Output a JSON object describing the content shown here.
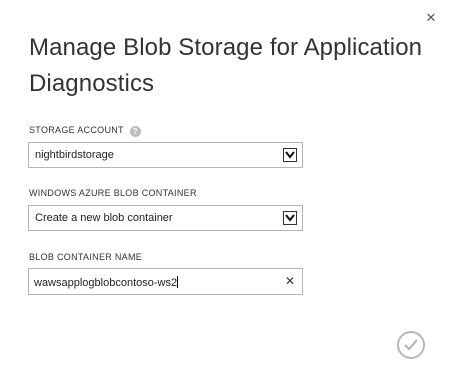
{
  "dialog": {
    "title": "Manage Blob Storage for Application Diagnostics",
    "close_icon": "close-icon",
    "ok_icon": "checkmark-icon"
  },
  "storage_account": {
    "label": "STORAGE ACCOUNT",
    "help_glyph": "?",
    "selected": "nightbirdstorage"
  },
  "blob_container": {
    "label": "WINDOWS AZURE BLOB CONTAINER",
    "selected": "Create a new blob container"
  },
  "container_name": {
    "label": "BLOB CONTAINER NAME",
    "value": "wawsapplogblobcontoso-ws2"
  },
  "colors": {
    "border": "#b5b5b5",
    "text": "#333333",
    "help_icon": "#bdbdbd",
    "ok_circle": "#b8b8b8"
  }
}
